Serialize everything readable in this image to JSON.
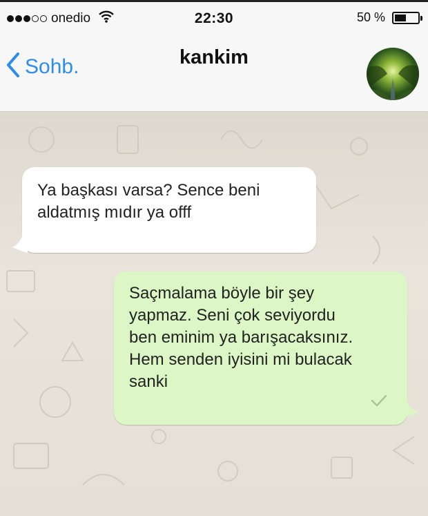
{
  "status_bar": {
    "carrier": "onedio",
    "signal_full": 3,
    "signal_empty": 2,
    "time": "22:30",
    "battery_text": "50 %",
    "battery_level": 0.5
  },
  "nav": {
    "back_label": "Sohb.",
    "title": "kankim",
    "accent": "#2e8de8"
  },
  "messages": [
    {
      "direction": "incoming",
      "text": "Ya başkası varsa? Sence beni\naldatmış mıdır ya offf"
    },
    {
      "direction": "outgoing",
      "text": "Saçmalama böyle bir şey\nyapmaz. Seni çok seviyordu\nben eminim ya barışacaksınız.\nHem senden iyisini mi bulacak\nsanki",
      "status_icon": "check-icon"
    }
  ],
  "colors": {
    "incoming_bubble": "#ffffff",
    "outgoing_bubble": "#dcf7c5",
    "chat_background": "#e6e1d8"
  }
}
